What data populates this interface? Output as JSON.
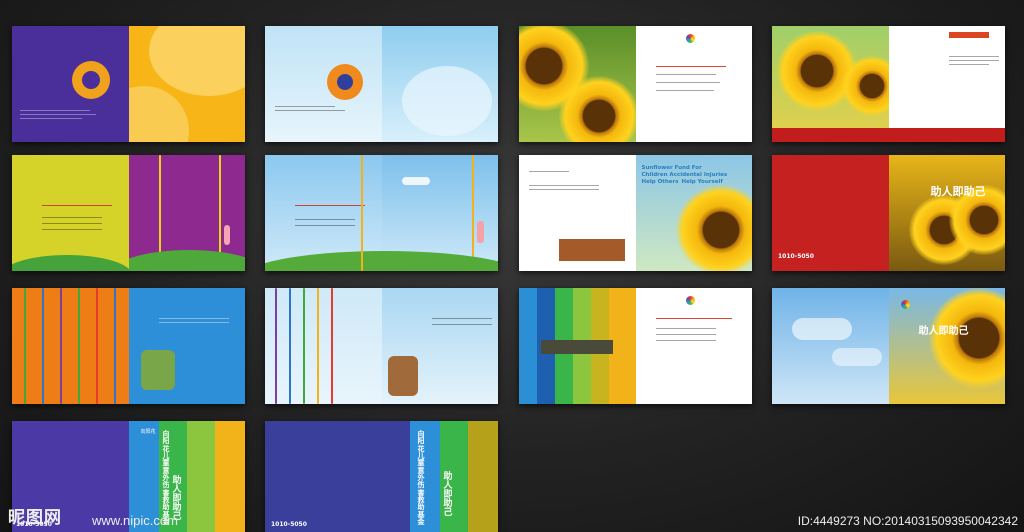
{
  "sheet": {
    "card_texts": {
      "sunflower_headline": [
        "Sunflower Fund For",
        "Children Accidental Injuries",
        "Help Others",
        "Help Yourself"
      ],
      "zhuren_title": "助人即助己",
      "vertical_title": "向阳花儿童意外伤害救助基金",
      "hotline": "1010-5050",
      "brand_small": "向阳花"
    },
    "watermark": {
      "brand": "昵图网",
      "url": "www.nipic.com",
      "id_line": "ID:4449273 NO:20140315093950042342"
    }
  }
}
